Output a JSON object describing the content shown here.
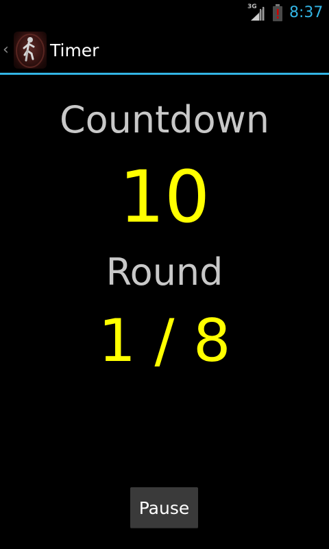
{
  "status_bar": {
    "network_type": "3G",
    "time": "8:37",
    "icons": [
      "signal-icon",
      "battery-alert-icon"
    ],
    "colors": {
      "time": "#33b5e5",
      "battery_alert": "#cc0000"
    }
  },
  "action_bar": {
    "title": "Timer",
    "icons": [
      "up-chevron-icon",
      "app-runner-icon"
    ],
    "divider_color": "#33b5e5"
  },
  "main": {
    "countdown_label": "Countdown",
    "countdown_value": "10",
    "round_label": "Round",
    "round_value": "1 / 8",
    "colors": {
      "label": "#c8c8c8",
      "value": "#ffff00"
    }
  },
  "controls": {
    "pause_label": "Pause"
  }
}
